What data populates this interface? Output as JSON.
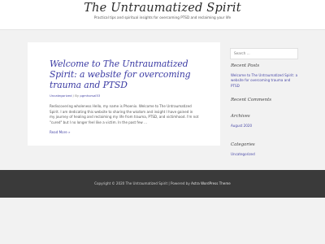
{
  "header": {
    "site_title": "The Untraumatized Spirit",
    "tagline": "Practical tips and spiritual insights for overcoming PTSD and reclaiming your life"
  },
  "article": {
    "title": "Welcome to The Untraumatized Spirit: a website for overcoming trauma and PTSD",
    "category": "Uncategorized",
    "meta_separator": "/",
    "author_prefix": "By",
    "author": "pgmhorsal53",
    "excerpt": "Rediscovering wholeness Hello, my name is Phoenix. Welcome to The Untraumatized Spirit. I am dedicating this website to sharing the wisdom and insight I have gained in my journey of healing and reclaiming my life from trauma, PTSD, and victimhood. I'm not \"cured\" but I no longer feel like a victim. In the past few …",
    "read_more": "Read More »"
  },
  "sidebar": {
    "search_placeholder": "Search ...",
    "recent_posts": {
      "title": "Recent Posts",
      "items": [
        "Welcome to The Untraumatized Spirit: a website for overcoming trauma and PTSD"
      ]
    },
    "recent_comments": {
      "title": "Recent Comments"
    },
    "archives": {
      "title": "Archives",
      "items": [
        "August 2020"
      ]
    },
    "categories": {
      "title": "Categories",
      "items": [
        "Uncategorized"
      ]
    }
  },
  "footer": {
    "copyright": "Copyright © 2020 The Untraumatized Spirit | Powered by",
    "theme_link": "Astra WordPress Theme"
  }
}
